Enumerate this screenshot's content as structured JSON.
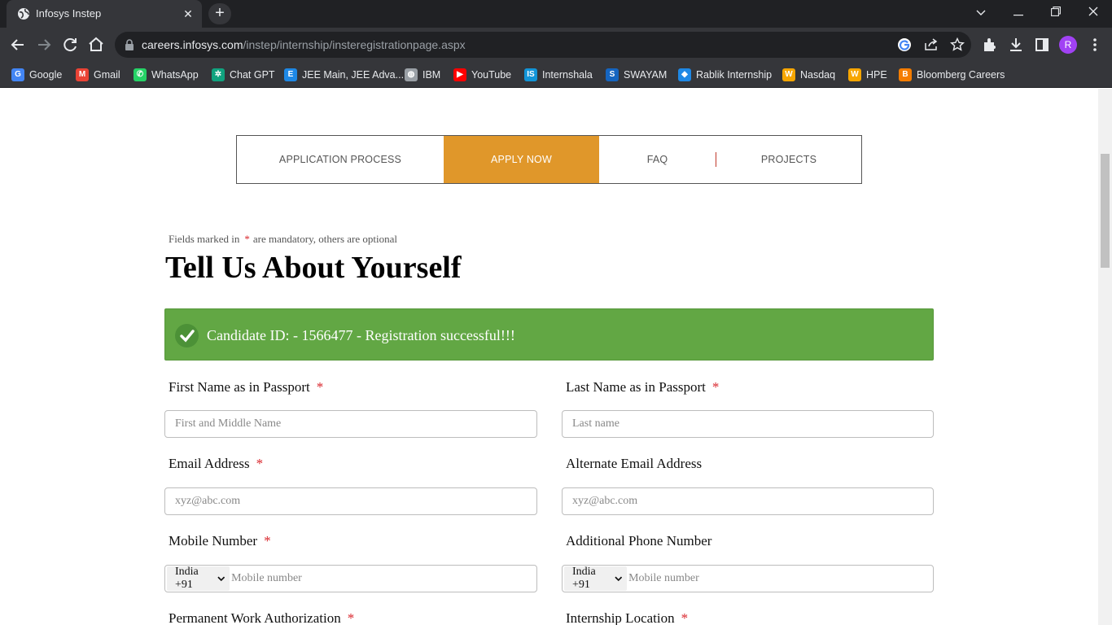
{
  "browser": {
    "tab_title": "Infosys Instep",
    "url_host": "careers.infosys.com",
    "url_path": "/instep/internship/insteregistrationpage.aspx",
    "profile_initial": "R",
    "bookmarks": [
      {
        "label": "Google",
        "icon": "google-icon",
        "color": "#4285f4"
      },
      {
        "label": "Gmail",
        "icon": "gmail-icon",
        "color": "#ea4335"
      },
      {
        "label": "WhatsApp",
        "icon": "whatsapp-icon",
        "color": "#25d366"
      },
      {
        "label": "Chat GPT",
        "icon": "chatgpt-icon",
        "color": "#10a37f"
      },
      {
        "label": "JEE Main, JEE Adva...",
        "icon": "jee-icon",
        "color": "#1e88e5"
      },
      {
        "label": "IBM",
        "icon": "globe-icon",
        "color": "#9aa0a6"
      },
      {
        "label": "YouTube",
        "icon": "youtube-icon",
        "color": "#ff0000"
      },
      {
        "label": "Internshala",
        "icon": "internshala-icon",
        "color": "#1295d8"
      },
      {
        "label": "SWAYAM",
        "icon": "swayam-icon",
        "color": "#1565c0"
      },
      {
        "label": "Rablik Internship",
        "icon": "rablik-icon",
        "color": "#1e88e5"
      },
      {
        "label": "Nasdaq",
        "icon": "nasdaq-icon",
        "color": "#f7a600"
      },
      {
        "label": "HPE",
        "icon": "hpe-icon",
        "color": "#f7a600"
      },
      {
        "label": "Bloomberg Careers",
        "icon": "blogger-icon",
        "color": "#f57d00"
      }
    ]
  },
  "nav": {
    "items": [
      "APPLICATION PROCESS",
      "APPLY NOW",
      "FAQ",
      "PROJECTS"
    ],
    "active": "APPLY NOW",
    "accent": "#e0972a"
  },
  "form": {
    "mandatory_prefix": "Fields marked in",
    "mandatory_star": "*",
    "mandatory_suffix": "are mandatory, others are optional",
    "heading": "Tell Us About Yourself",
    "alert_message": "Candidate ID: - 1566477 - Registration successful!!!",
    "alert_color": "#62a744",
    "first_name_label": "First Name as in Passport",
    "first_name_placeholder": "First and Middle Name",
    "last_name_label": "Last Name as in Passport",
    "last_name_placeholder": "Last name",
    "email_label": "Email Address",
    "email_placeholder": "xyz@abc.com",
    "alt_email_label": "Alternate Email Address",
    "alt_email_placeholder": "xyz@abc.com",
    "mobile_label": "Mobile Number",
    "mobile_country_code": "India +91",
    "mobile_placeholder": "Mobile number",
    "additional_phone_label": "Additional Phone Number",
    "additional_country_code": "India +91",
    "additional_placeholder": "Mobile number",
    "work_auth_label": "Permanent Work Authorization",
    "location_label": "Internship Location",
    "required_mark": "*"
  }
}
